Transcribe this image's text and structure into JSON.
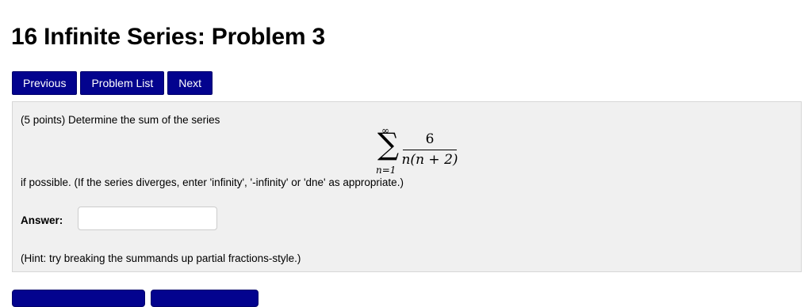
{
  "page": {
    "title": "16 Infinite Series: Problem 3"
  },
  "nav": {
    "previous_label": "Previous",
    "problem_list_label": "Problem List",
    "next_label": "Next"
  },
  "problem": {
    "intro": "(5 points) Determine the sum of the series",
    "series": {
      "sum_symbol": "∑",
      "upper_limit": "∞",
      "lower_limit": "n=1",
      "numerator": "6",
      "denominator": "n(n + 2)"
    },
    "instructions": "if possible. (If the series diverges, enter 'infinity', '-infinity' or 'dne' as appropriate.)",
    "answer_label": "Answer:",
    "answer_value": "",
    "hint": "(Hint: try breaking the summands up partial fractions-style.)"
  },
  "colors": {
    "button_bg": "#03038e",
    "panel_bg": "#f0f0f0"
  }
}
